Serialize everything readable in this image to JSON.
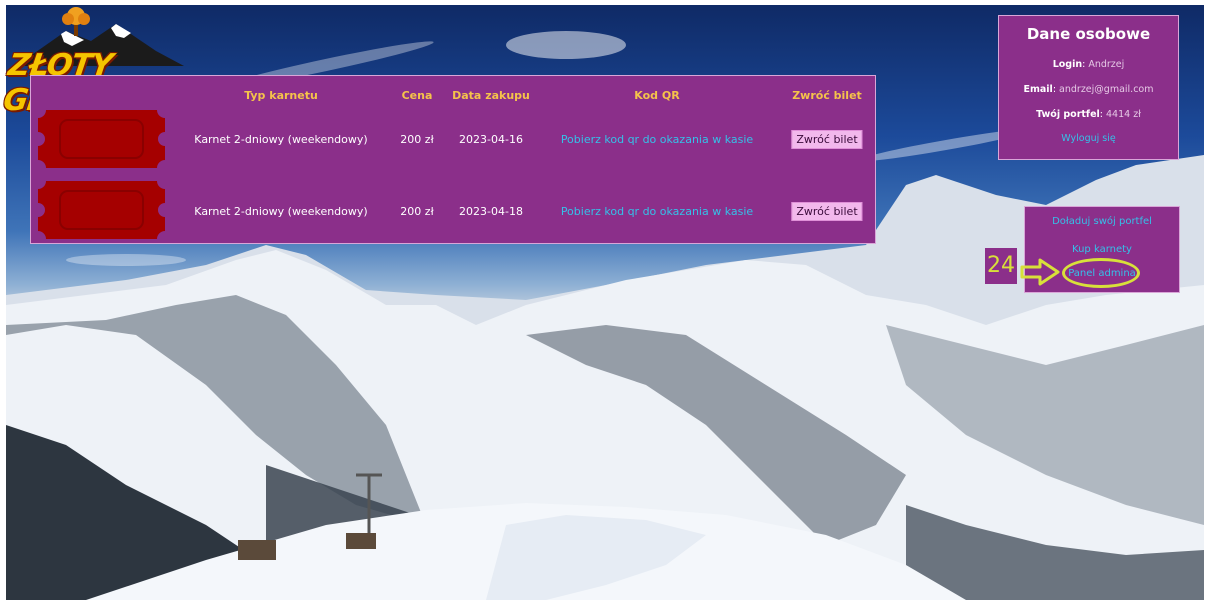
{
  "brand": {
    "logo_text": "ZŁOTY GROŃ"
  },
  "tickets_table": {
    "headers": {
      "type": "Typ karnetu",
      "price": "Cena",
      "date": "Data zakupu",
      "qr": "Kod QR",
      "return": "Zwróć bilet"
    },
    "rows": [
      {
        "type": "Karnet 2-dniowy (weekendowy)",
        "price": "200 zł",
        "date": "2023-04-16",
        "qr": "Pobierz kod qr do okazania w kasie",
        "return": "Zwróć bilet"
      },
      {
        "type": "Karnet 2-dniowy (weekendowy)",
        "price": "200 zł",
        "date": "2023-04-18",
        "qr": "Pobierz kod qr do okazania w kasie",
        "return": "Zwróć bilet"
      }
    ]
  },
  "personal": {
    "title": "Dane osobowe",
    "login_label": "Login",
    "login_value": "Andrzej",
    "email_label": "Email",
    "email_value": "andrzej@gmail.com",
    "wallet_label": "Twój portfel",
    "wallet_value": "4414 zł",
    "logout": "Wyloguj się"
  },
  "actions": {
    "topup": "Doładuj swój portfel",
    "buy": "Kup karnety",
    "admin": "Panel admina"
  },
  "annotation": {
    "step": "24",
    "color": "#d8e03a"
  },
  "colors": {
    "panel": "#8b2f8a",
    "header_text": "#f5c34a",
    "link": "#35c1e8",
    "ticket": "#a50000"
  }
}
